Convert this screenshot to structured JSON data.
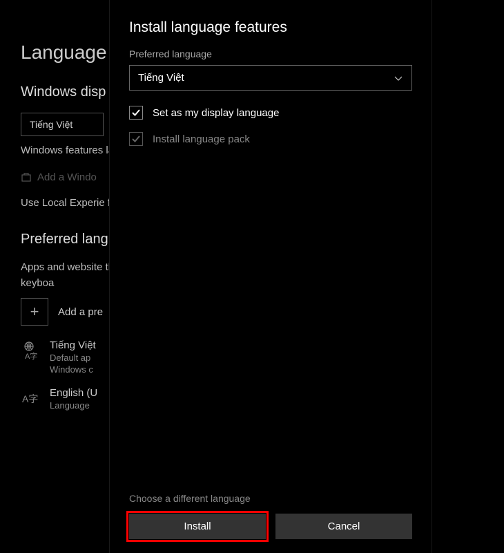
{
  "background": {
    "page_title": "Language",
    "display_heading": "Windows disp",
    "display_value": "Tiếng Việt",
    "display_desc": "Windows features language.",
    "store_link": "Add a Windo",
    "lep_desc": "Use Local Experie for navigation, me",
    "preferred_heading": "Preferred lang",
    "preferred_desc": "Apps and website they support. Sele configure keyboa",
    "add_label": "Add a pre",
    "lang1_name": "Tiếng Việt",
    "lang1_sub1": "Default ap",
    "lang1_sub2": "Windows c",
    "lang2_name": "English (U",
    "lang2_sub": "Language"
  },
  "dialog": {
    "title": "Install language features",
    "preferred_label": "Preferred language",
    "selected_language": "Tiếng Việt",
    "check_display": "Set as my display language",
    "check_pack": "Install language pack",
    "alt_link": "Choose a different language",
    "install_btn": "Install",
    "cancel_btn": "Cancel"
  }
}
